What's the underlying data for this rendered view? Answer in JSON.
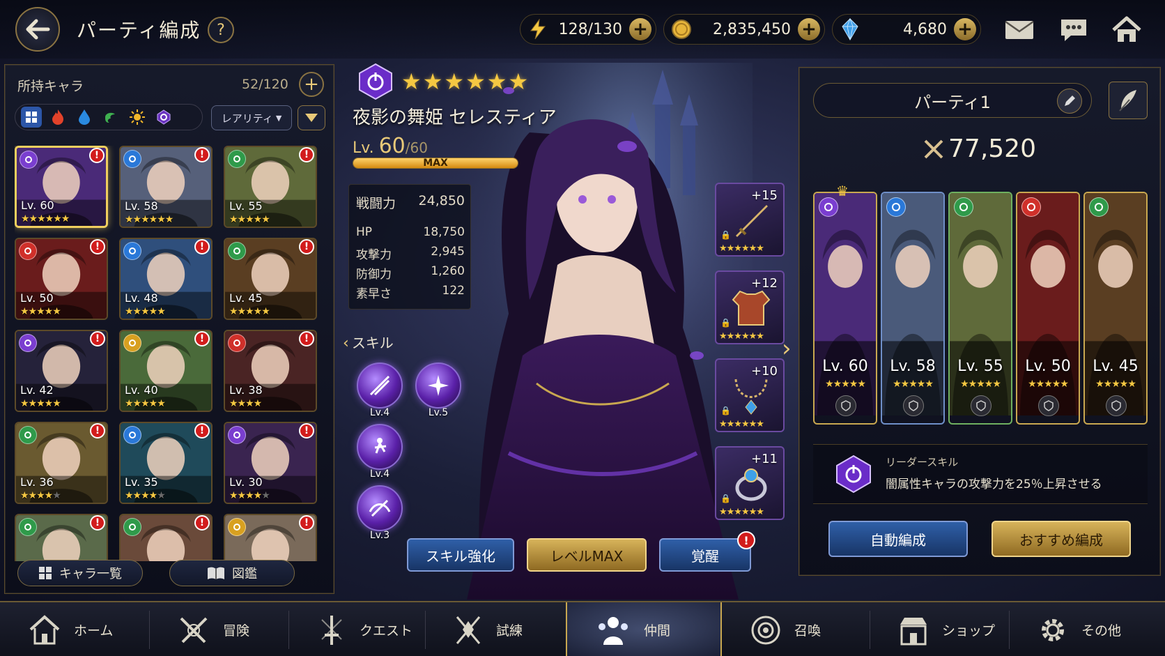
{
  "header": {
    "title": "パーティ編成",
    "help": "?",
    "stamina": "128/130",
    "gold": "2,835,450",
    "gems": "4,680"
  },
  "roster": {
    "heading": "所持キャラ",
    "count": "52/120",
    "sort_label": "レアリティ",
    "list_button": "キャラ一覧",
    "codex_button": "図鑑",
    "cards": [
      {
        "lv": "Lv. 60",
        "stars": 6,
        "max": 6,
        "elem": "dark",
        "theme": "#4a2a78"
      },
      {
        "lv": "Lv. 58",
        "stars": 6,
        "max": 6,
        "elem": "water",
        "theme": "#56607a"
      },
      {
        "lv": "Lv. 55",
        "stars": 5,
        "max": 5,
        "elem": "wind",
        "theme": "#5f6a3a"
      },
      {
        "lv": "Lv. 50",
        "stars": 5,
        "max": 5,
        "elem": "fire",
        "theme": "#6a1c1c"
      },
      {
        "lv": "Lv. 48",
        "stars": 5,
        "max": 5,
        "elem": "water",
        "theme": "#2f4f7c"
      },
      {
        "lv": "Lv. 45",
        "stars": 5,
        "max": 5,
        "elem": "wind",
        "theme": "#5a3e22"
      },
      {
        "lv": "Lv. 42",
        "stars": 5,
        "max": 5,
        "elem": "dark",
        "theme": "#25223a"
      },
      {
        "lv": "Lv. 40",
        "stars": 5,
        "max": 5,
        "elem": "light",
        "theme": "#4a6a3a"
      },
      {
        "lv": "Lv. 38",
        "stars": 4,
        "max": 4,
        "elem": "fire",
        "theme": "#4a2424"
      },
      {
        "lv": "Lv. 36",
        "stars": 4,
        "max": 5,
        "elem": "wind",
        "theme": "#6a5a30"
      },
      {
        "lv": "Lv. 35",
        "stars": 4,
        "max": 5,
        "elem": "water",
        "theme": "#1f4a5a"
      },
      {
        "lv": "Lv. 30",
        "stars": 4,
        "max": 5,
        "elem": "dark",
        "theme": "#3a2450"
      },
      {
        "lv": "",
        "stars": 0,
        "max": 0,
        "elem": "wind",
        "theme": "#5a6a4a"
      },
      {
        "lv": "",
        "stars": 0,
        "max": 0,
        "elem": "wind",
        "theme": "#6a4a3a"
      },
      {
        "lv": "",
        "stars": 0,
        "max": 0,
        "elem": "light",
        "theme": "#7a6a5a"
      }
    ]
  },
  "character": {
    "name": "夜影の舞姫 セレスティア",
    "lv_prefix": "Lv.",
    "level": "60",
    "level_max": "/60",
    "rarity": "★★★★★★",
    "bar_label": "MAX",
    "bar_fill": 1.0,
    "stats": [
      {
        "label": "戦闘力",
        "value": "24,850"
      },
      {
        "label": "HP",
        "value": "18,750"
      },
      {
        "label": "攻撃力",
        "value": "2,945"
      },
      {
        "label": "防御力",
        "value": "1,260"
      },
      {
        "label": "素早さ",
        "value": "122"
      }
    ],
    "skills_heading": "スキル",
    "skills": [
      "Lv.4",
      "Lv.5",
      "Lv.4",
      "Lv.3"
    ],
    "equipment": [
      {
        "plus": "+15",
        "stars": "★★★★★★"
      },
      {
        "plus": "+12",
        "stars": "★★★★★★"
      },
      {
        "plus": "+10",
        "stars": "★★★★★★"
      },
      {
        "plus": "+11",
        "stars": "★★★★★★"
      }
    ],
    "buttons": {
      "skill": "スキル強化",
      "level": "レベルMAX",
      "awaken": "覚醒",
      "alert": "!"
    }
  },
  "party": {
    "name": "パーティ1",
    "power": "77,520",
    "members": [
      {
        "lv": "Lv. 60",
        "elem": "dark",
        "theme": "#4a2a78",
        "border": "#c9a850"
      },
      {
        "lv": "Lv. 58",
        "elem": "water",
        "theme": "#4a5a7a",
        "border": "#6f8fc8"
      },
      {
        "lv": "Lv. 55",
        "elem": "wind",
        "theme": "#5f6a3a",
        "border": "#6fb060"
      },
      {
        "lv": "Lv. 50",
        "elem": "fire",
        "theme": "#6a1c1c",
        "border": "#c9a850"
      },
      {
        "lv": "Lv. 45",
        "elem": "wind",
        "theme": "#5a3e22",
        "border": "#c9a850"
      }
    ],
    "member_stars": "★★★★★",
    "leader_title": "リーダースキル",
    "leader_desc": "闇属性キャラの攻撃力を25％上昇させる",
    "auto_button": "自動編成",
    "recommend_button": "おすすめ編成"
  },
  "nav": [
    {
      "label": "ホーム",
      "icon": "home-icon"
    },
    {
      "label": "冒険",
      "icon": "crossed-swords-icon"
    },
    {
      "label": "クエスト",
      "icon": "quest-sword-icon"
    },
    {
      "label": "試練",
      "icon": "trial-icon"
    },
    {
      "label": "仲間",
      "icon": "party-icon"
    },
    {
      "label": "召喚",
      "icon": "summon-icon"
    },
    {
      "label": "ショップ",
      "icon": "shop-icon"
    },
    {
      "label": "その他",
      "icon": "gear-icon"
    }
  ],
  "colors": {
    "dark": "#7a3ed0",
    "water": "#2a78d8",
    "wind": "#2f9a4a",
    "fire": "#d0302a",
    "light": "#d8a020"
  }
}
